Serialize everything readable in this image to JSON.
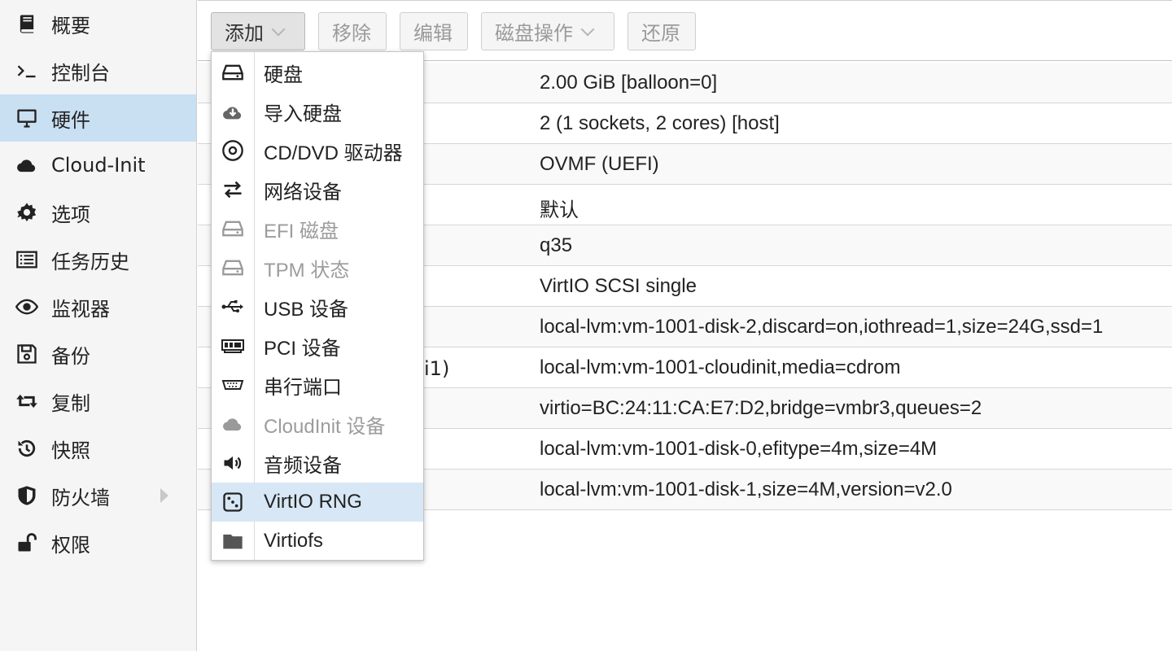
{
  "sidebar": {
    "items": [
      {
        "label": "概要",
        "icon": "book-icon"
      },
      {
        "label": "控制台",
        "icon": "terminal-icon"
      },
      {
        "label": "硬件",
        "icon": "desktop-icon",
        "selected": true
      },
      {
        "label": "Cloud-Init",
        "icon": "cloud-icon"
      },
      {
        "label": "选项",
        "icon": "gear-icon"
      },
      {
        "label": "任务历史",
        "icon": "list-icon"
      },
      {
        "label": "监视器",
        "icon": "eye-icon"
      },
      {
        "label": "备份",
        "icon": "floppy-icon"
      },
      {
        "label": "复制",
        "icon": "retweet-icon"
      },
      {
        "label": "快照",
        "icon": "history-icon"
      },
      {
        "label": "防火墙",
        "icon": "shield-icon",
        "has_submenu": true
      },
      {
        "label": "权限",
        "icon": "unlock-icon"
      }
    ]
  },
  "toolbar": {
    "add_label": "添加",
    "remove_label": "移除",
    "edit_label": "编辑",
    "disk_action_label": "磁盘操作",
    "revert_label": "还原"
  },
  "hardware_rows": [
    {
      "name": "",
      "value": "2.00 GiB [balloon=0]"
    },
    {
      "name": "",
      "value": "2 (1 sockets, 2 cores) [host]"
    },
    {
      "name": "",
      "value": "OVMF (UEFI)"
    },
    {
      "name": "",
      "value": "默认"
    },
    {
      "name": "",
      "value": "q35"
    },
    {
      "name": "",
      "value": "VirtIO SCSI single"
    },
    {
      "name": "",
      "value": "local-lvm:vm-1001-disk-2,discard=on,iothread=1,size=24G,ssd=1"
    },
    {
      "name": "i1)",
      "value": "local-lvm:vm-1001-cloudinit,media=cdrom"
    },
    {
      "name": "",
      "value": "virtio=BC:24:11:CA:E7:D2,bridge=vmbr3,queues=2"
    },
    {
      "name": "",
      "value": "local-lvm:vm-1001-disk-0,efitype=4m,size=4M"
    },
    {
      "name": "",
      "value": "local-lvm:vm-1001-disk-1,size=4M,version=v2.0"
    }
  ],
  "add_menu": {
    "items": [
      {
        "label": "硬盘",
        "icon": "hdd-icon"
      },
      {
        "label": "导入硬盘",
        "icon": "cloud-download-icon"
      },
      {
        "label": "CD/DVD 驱动器",
        "icon": "optical-disc-icon"
      },
      {
        "label": "网络设备",
        "icon": "exchange-icon"
      },
      {
        "label": "EFI 磁盘",
        "icon": "hdd-icon",
        "disabled": true
      },
      {
        "label": "TPM 状态",
        "icon": "hdd-icon",
        "disabled": true
      },
      {
        "label": "USB 设备",
        "icon": "usb-icon"
      },
      {
        "label": "PCI 设备",
        "icon": "pci-card-icon"
      },
      {
        "label": "串行端口",
        "icon": "serial-port-icon"
      },
      {
        "label": "CloudInit 设备",
        "icon": "cloud-icon",
        "disabled": true
      },
      {
        "label": "音频设备",
        "icon": "volume-icon"
      },
      {
        "label": "VirtIO RNG",
        "icon": "dice-icon",
        "highlighted": true
      },
      {
        "label": "Virtiofs",
        "icon": "folder-icon"
      }
    ]
  }
}
